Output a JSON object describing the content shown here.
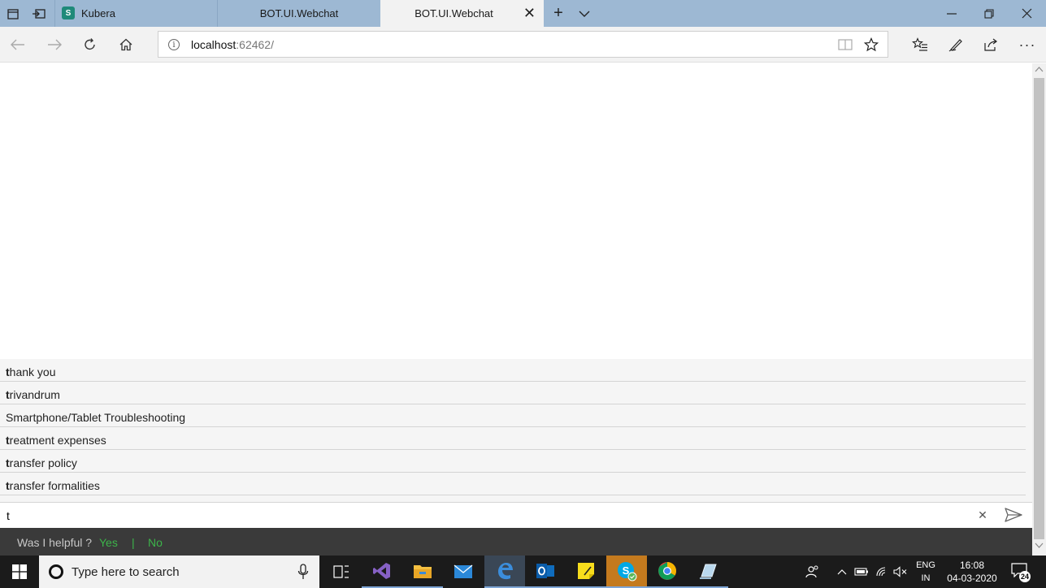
{
  "browser": {
    "tabs": [
      {
        "label": "Kubera",
        "favicon": "sharepoint-icon",
        "active": false
      },
      {
        "label": "BOT.UI.Webchat",
        "active": false
      },
      {
        "label": "BOT.UI.Webchat",
        "active": true
      }
    ],
    "address": {
      "host": "localhost",
      "port": ":62462/"
    }
  },
  "suggestions": [
    {
      "match": "t",
      "rest": "hank you"
    },
    {
      "match": "t",
      "rest": "rivandrum"
    },
    {
      "match": "",
      "rest": "Smartphone/Tablet Troubleshooting"
    },
    {
      "match": "t",
      "rest": "reatment expenses"
    },
    {
      "match": "t",
      "rest": "ransfer policy"
    },
    {
      "match": "t",
      "rest": "ransfer formalities"
    }
  ],
  "chat": {
    "input_value": "t"
  },
  "feedback": {
    "question": "Was I helpful ?",
    "yes": "Yes",
    "separator": "|",
    "no": "No"
  },
  "taskbar": {
    "search_placeholder": "Type here to search",
    "lang": {
      "line1": "ENG",
      "line2": "IN"
    },
    "clock": {
      "time": "16:08",
      "date": "04-03-2020"
    },
    "notifications": "24"
  },
  "colors": {
    "accent_green": "#3cb44a",
    "tab_bar": "#9db8d3",
    "feedback_bg": "#3a3a3a"
  }
}
